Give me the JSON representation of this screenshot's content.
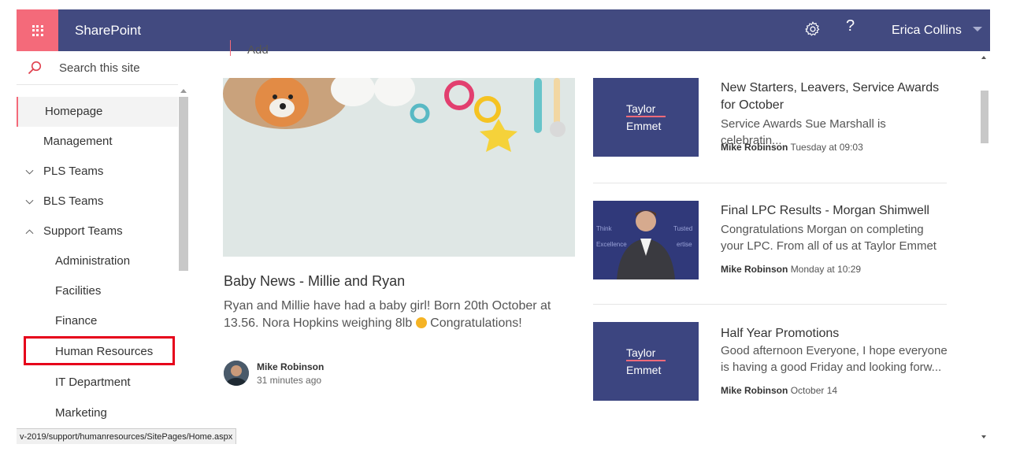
{
  "app": {
    "name": "SharePoint",
    "brand_color": "#424a80",
    "accent_color": "#f46a7a"
  },
  "header": {
    "user_name": "Erica Collins",
    "help_glyph": "?",
    "settings_icon": "gear-icon",
    "waffle_icon": "app-launcher-icon"
  },
  "sidebar": {
    "search_placeholder": "Search this site",
    "items": [
      {
        "label": "Homepage",
        "active": true
      },
      {
        "label": "Management"
      },
      {
        "label": "PLS Teams",
        "expander": "chevron-down"
      },
      {
        "label": "BLS Teams",
        "expander": "chevron-down"
      },
      {
        "label": "Support Teams",
        "expander": "chevron-up"
      },
      {
        "label": "Administration",
        "child": true
      },
      {
        "label": "Facilities",
        "child": true
      },
      {
        "label": "Finance",
        "child": true
      },
      {
        "label": "Human Resources",
        "child": true,
        "highlighted": true
      },
      {
        "label": "IT Department",
        "child": true
      },
      {
        "label": "Marketing",
        "child": true
      }
    ]
  },
  "main": {
    "add_label": "Add",
    "hero": {
      "title": "Baby News - Millie and Ryan",
      "description_part1": "Ryan and Millie have had a baby girl! Born 20th October at 13.56. Nora Hopkins weighing 8lb",
      "description_part2": " Congratulations!",
      "author": "Mike Robinson",
      "time": "31 minutes ago"
    },
    "news": [
      {
        "title": "New Starters, Leavers, Service Awards for October",
        "description": "Service Awards Sue Marshall is celebratin...",
        "author": "Mike Robinson",
        "time": "Tuesday at 09:03",
        "thumb_line1": "Taylor",
        "thumb_line2": "Emmet"
      },
      {
        "title": "Final LPC Results - Morgan Shimwell",
        "description": "Congratulations Morgan on completing your LPC. From all of us at Taylor Emmet",
        "author": "Mike Robinson",
        "time": "Monday at 10:29",
        "thumb_word1": "Think",
        "thumb_word2": "Excellence",
        "thumb_word3": "Tusted",
        "thumb_word4": "ertise"
      },
      {
        "title": "Half Year Promotions",
        "description": "Good afternoon Everyone, I hope everyone is having a good Friday and looking forw...",
        "author": "Mike Robinson",
        "time": "October 14",
        "thumb_line1": "Taylor",
        "thumb_line2": "Emmet"
      }
    ]
  },
  "status_bar": {
    "url": "v-2019/support/humanresources/SitePages/Home.aspx"
  }
}
